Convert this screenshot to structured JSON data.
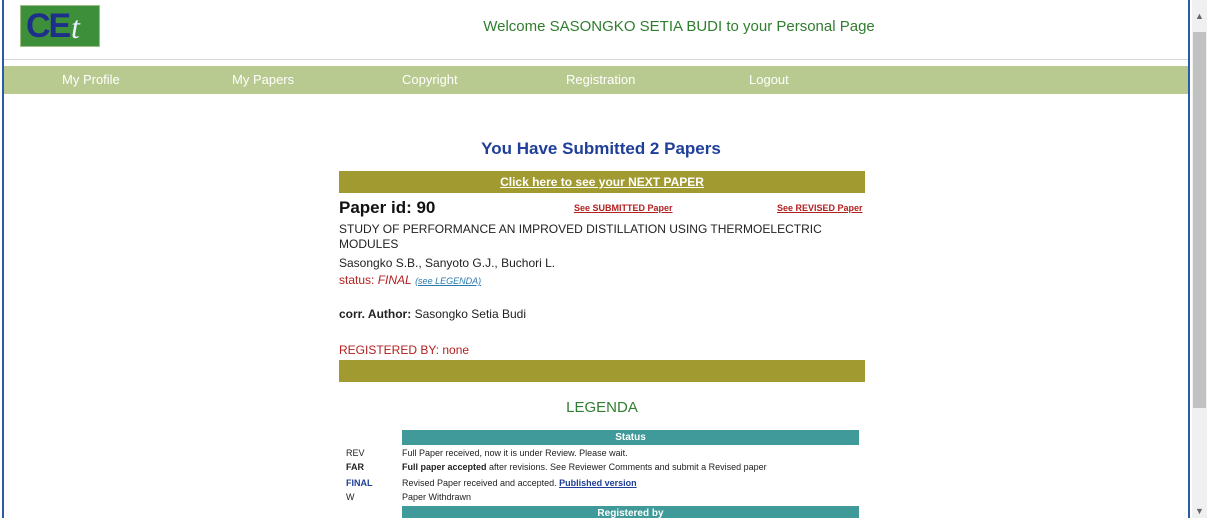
{
  "header": {
    "logo_text": "CE",
    "logo_t": "t",
    "welcome": "Welcome SASONGKO SETIA BUDI to your Personal Page"
  },
  "nav": {
    "items": [
      {
        "label": "My Profile"
      },
      {
        "label": "My Papers"
      },
      {
        "label": "Copyright"
      },
      {
        "label": "Registration"
      },
      {
        "label": "Logout"
      }
    ]
  },
  "main": {
    "heading": "You Have Submitted 2 Papers",
    "next_link": "Click here to see your NEXT PAPER",
    "paper": {
      "id_label": "Paper id: 90",
      "submitted_link": "See SUBMITTED Paper",
      "revised_link": "See REVISED Paper",
      "title": "STUDY OF PERFORMANCE AN IMPROVED DISTILLATION USING THERMOELECTRIC MODULES",
      "authors": "Sasongko S.B., Sanyoto G.J., Buchori L.",
      "status_label": "status:",
      "status_value": "FINAL",
      "legend_link": "(see LEGENDA)",
      "corr_label": "corr. Author:",
      "corr_value": "Sasongko Setia Budi",
      "registered_by": "REGISTERED BY: none"
    }
  },
  "legenda": {
    "title": "LEGENDA",
    "status_header": "Status",
    "rows": [
      {
        "code": "REV",
        "desc": "Full Paper received, now it is under Review. Please wait."
      },
      {
        "code": "FAR",
        "desc_bold": "Full paper accepted",
        "desc": " after revisions. See Reviewer Comments and submit a Revised paper"
      },
      {
        "code": "FINAL",
        "desc": "Revised Paper received and accepted. ",
        "desc_link": "Published version"
      },
      {
        "code": "W",
        "desc": "Paper Withdrawn"
      }
    ],
    "registered_header": "Registered by"
  },
  "colors": {
    "nav_bg": "#b8ca90",
    "bar_olive": "#a19a30",
    "teal": "#3f9a99",
    "heading_blue": "#1f3f99",
    "status_red": "#b32020",
    "legenda_green": "#2f7d2f"
  }
}
